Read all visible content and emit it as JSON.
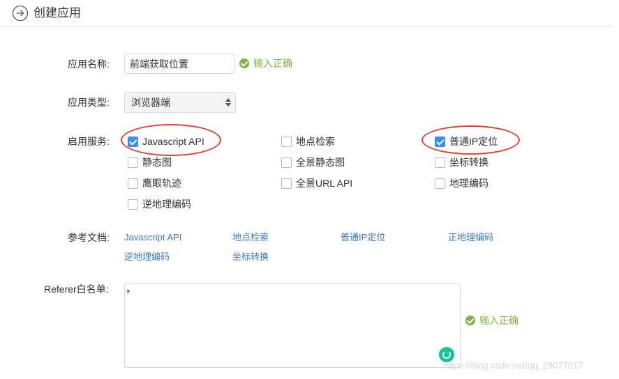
{
  "header": {
    "title": "创建应用"
  },
  "form": {
    "name": {
      "label": "应用名称:",
      "value": "前端获取位置",
      "valid_msg": "输入正确"
    },
    "type": {
      "label": "应用类型:",
      "selected": "浏览器端"
    },
    "services": {
      "label": "启用服务:",
      "items": [
        {
          "label": "Javascript API",
          "checked": true
        },
        {
          "label": "地点检索",
          "checked": false
        },
        {
          "label": "普通IP定位",
          "checked": true
        },
        {
          "label": "静态图",
          "checked": false
        },
        {
          "label": "全景静态图",
          "checked": false
        },
        {
          "label": "坐标转换",
          "checked": false
        },
        {
          "label": "鹰眼轨迹",
          "checked": false
        },
        {
          "label": "全景URL API",
          "checked": false
        },
        {
          "label": "地理编码",
          "checked": false
        },
        {
          "label": "逆地理编码",
          "checked": false
        }
      ]
    },
    "docs": {
      "label": "参考文档:",
      "links": [
        "Javascript API",
        "地点检索",
        "普通IP定位",
        "正地理编码",
        "逆地理编码",
        "坐标转换"
      ]
    },
    "referer": {
      "label": "Referer白名单:",
      "value": "*",
      "valid_msg": "输入正确"
    }
  },
  "watermark": "https://blog.csdn.net/qq_29077017",
  "colors": {
    "success": "#7cb342",
    "link": "#3b78c8",
    "checkbox_checked": "#3b8ff0",
    "annotation": "#e8402f"
  }
}
